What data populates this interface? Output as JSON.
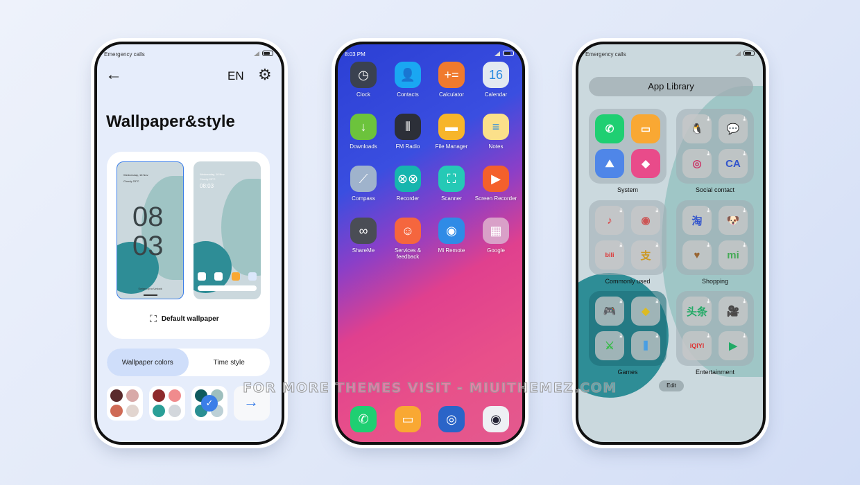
{
  "phone1": {
    "status_text": "Emergency calls",
    "language": "EN",
    "title": "Wallpaper&style",
    "lock_preview": {
      "date": "Wednesday, 16 Nov",
      "weather": "Cloudy 23°C",
      "hour": "08",
      "minute": "03",
      "hint": "Swipe up to Unlock"
    },
    "home_preview": {
      "date": "Wednesday, 16 Nov",
      "weather": "Cloudy 23°C",
      "time": "08:03"
    },
    "default_wallpaper_label": "Default wallpaper",
    "tabs": [
      {
        "label": "Wallpaper colors",
        "active": true
      },
      {
        "label": "Time style",
        "active": false
      }
    ],
    "swatches": [
      {
        "colors": [
          "#5a2a2c",
          "#d8a9a8",
          "#cf6a55",
          "#e2d5cf"
        ],
        "selected": false
      },
      {
        "colors": [
          "#8e2a2c",
          "#f08b8d",
          "#2a9f97",
          "#d3d7dc"
        ],
        "selected": false
      },
      {
        "colors": [
          "#0f5a5e",
          "#9ebfbe",
          "#2a8f93",
          "#bcd0d6"
        ],
        "selected": true
      }
    ],
    "accent": "#3b7ee8"
  },
  "phone2": {
    "time": "8:03 PM",
    "apps": [
      {
        "label": "Clock",
        "icon": "clock-icon",
        "color": "#3a4150",
        "glyph": "◷"
      },
      {
        "label": "Contacts",
        "icon": "contacts-icon",
        "color": "#1aa7f2",
        "glyph": "👤"
      },
      {
        "label": "Calculator",
        "icon": "calculator-icon",
        "color": "#f07a2e",
        "glyph": "+="
      },
      {
        "label": "Calendar",
        "icon": "calendar-icon",
        "color": "#e3e9f1",
        "glyph": "16"
      },
      {
        "label": "Downloads",
        "icon": "download-icon",
        "color": "#6cc33c",
        "glyph": "↓"
      },
      {
        "label": "FM Radio",
        "icon": "radio-icon",
        "color": "#2c2f38",
        "glyph": "⦀"
      },
      {
        "label": "File Manager",
        "icon": "folder-icon",
        "color": "#f7b52b",
        "glyph": "▬"
      },
      {
        "label": "Notes",
        "icon": "notes-icon",
        "color": "#fbe08a",
        "glyph": "≡"
      },
      {
        "label": "Compass",
        "icon": "compass-icon",
        "color": "#9fb3cc",
        "glyph": "⟋"
      },
      {
        "label": "Recorder",
        "icon": "recorder-icon",
        "color": "#16b5ae",
        "glyph": "⊗⊗"
      },
      {
        "label": "Scanner",
        "icon": "scanner-icon",
        "color": "#25c9b6",
        "glyph": "⛶"
      },
      {
        "label": "Screen Recorder",
        "icon": "screen-recorder-icon",
        "color": "#f4602c",
        "glyph": "▶"
      },
      {
        "label": "ShareMe",
        "icon": "shareme-icon",
        "color": "#4a4d55",
        "glyph": "∞"
      },
      {
        "label": "Services & feedback",
        "icon": "feedback-icon",
        "color": "#f5663e",
        "glyph": "☺"
      },
      {
        "label": "Mi Remote",
        "icon": "remote-icon",
        "color": "#2f8be6",
        "glyph": "◉"
      },
      {
        "label": "Google",
        "icon": "google-folder-icon",
        "color": "#d9a0c8",
        "glyph": "▦"
      }
    ],
    "dock": [
      {
        "icon": "phone-icon",
        "color": "#1fcf72",
        "glyph": "✆"
      },
      {
        "icon": "messages-icon",
        "color": "#f9a833",
        "glyph": "▭"
      },
      {
        "icon": "chrome-icon",
        "color": "#2a64c8",
        "glyph": "◎"
      },
      {
        "icon": "camera-icon",
        "color": "#eef0f4",
        "glyph": "◉"
      }
    ]
  },
  "phone3": {
    "status_text": "Emergency calls",
    "header": "App Library",
    "folders": [
      {
        "label": "System",
        "apps": [
          {
            "icon": "phone-icon",
            "color": "#1fcf72",
            "glyph": "✆"
          },
          {
            "icon": "messages-icon",
            "color": "#f9a833",
            "glyph": "▭"
          },
          {
            "icon": "gallery-icon",
            "color": "#4f86e8",
            "glyph": "⛰"
          },
          {
            "icon": "themes-icon",
            "color": "#e94b8a",
            "glyph": "◆"
          }
        ]
      },
      {
        "label": "Social contact",
        "apps": [
          {
            "icon": "qq-icon",
            "glyph": "🐧"
          },
          {
            "icon": "wechat-icon",
            "glyph": "💬"
          },
          {
            "icon": "weibo-icon",
            "glyph": "◎"
          },
          {
            "icon": "ca-icon",
            "glyph": "CA"
          }
        ]
      },
      {
        "label": "Commonly used",
        "apps": [
          {
            "icon": "tiktok-icon",
            "glyph": "♪"
          },
          {
            "icon": "netease-music-icon",
            "glyph": "◉"
          },
          {
            "icon": "bilibili-icon",
            "glyph": "bili"
          },
          {
            "icon": "alipay-icon",
            "glyph": "支"
          }
        ]
      },
      {
        "label": "Shopping",
        "apps": [
          {
            "icon": "taobao-icon",
            "glyph": "淘"
          },
          {
            "icon": "jd-icon",
            "glyph": "🐶"
          },
          {
            "icon": "pinduoduo-icon",
            "glyph": "♥"
          },
          {
            "icon": "mi-store-icon",
            "glyph": "mi"
          }
        ]
      },
      {
        "label": "Games",
        "apps": [
          {
            "icon": "game-center-icon",
            "glyph": "🎮"
          },
          {
            "icon": "pubg-icon",
            "glyph": "◆"
          },
          {
            "icon": "honor-of-kings-icon",
            "glyph": "⚔"
          },
          {
            "icon": "podcasts-icon",
            "glyph": "⫼"
          }
        ]
      },
      {
        "label": "Entertainment",
        "apps": [
          {
            "icon": "toutiao-icon",
            "glyph": "头条"
          },
          {
            "icon": "video-camera-icon",
            "glyph": "🎥"
          },
          {
            "icon": "iqiyi-icon",
            "glyph": "iQIYI"
          },
          {
            "icon": "tencent-video-icon",
            "glyph": "▶"
          }
        ]
      }
    ],
    "edit_label": "Edit"
  },
  "watermark": "FOR MORE THEMES VISIT - MIUITHEMEZ.COM"
}
